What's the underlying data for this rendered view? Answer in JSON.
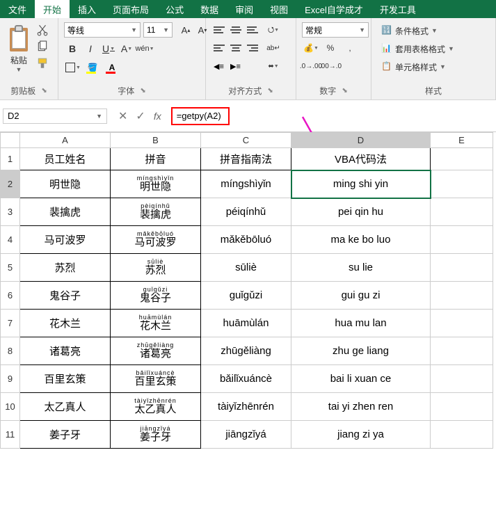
{
  "tabs": [
    "文件",
    "开始",
    "插入",
    "页面布局",
    "公式",
    "数据",
    "审阅",
    "视图",
    "Excel自学成才",
    "开发工具"
  ],
  "active_tab": 1,
  "font": {
    "name": "等线",
    "size": "11"
  },
  "number_format": "常规",
  "groups": {
    "clipboard": "剪贴板",
    "paste": "粘贴",
    "font": "字体",
    "align": "对齐方式",
    "number": "数字",
    "styles": "样式"
  },
  "style_btns": {
    "cond": "条件格式",
    "table": "套用表格格式",
    "cell": "单元格样式"
  },
  "name_box": "D2",
  "formula": "=getpy(A2)",
  "cols": [
    "A",
    "B",
    "C",
    "D",
    "E"
  ],
  "row_nums": [
    "1",
    "2",
    "3",
    "4",
    "5",
    "6",
    "7",
    "8",
    "9",
    "10",
    "11"
  ],
  "header": {
    "A": "员工姓名",
    "B": "拼音",
    "C": "拼音指南法",
    "D": "VBA代码法"
  },
  "rows": [
    {
      "A": "明世隐",
      "B_top": "míngshìyǐn",
      "B": "明世隐",
      "C": "míngshìyǐn",
      "D": "ming shi yin"
    },
    {
      "A": "裴擒虎",
      "B_top": "pèiqínhǔ",
      "B": "裴擒虎",
      "C": "péiqínhǔ",
      "D": "pei qin hu"
    },
    {
      "A": "马可波罗",
      "B_top": "mǎkěbōluó",
      "B": "马可波罗",
      "C": "mǎkěbōluó",
      "D": "ma ke bo luo"
    },
    {
      "A": "苏烈",
      "B_top": "sūliè",
      "B": "苏烈",
      "C": "sūliè",
      "D": "su lie"
    },
    {
      "A": "鬼谷子",
      "B_top": "guǐgǔzi",
      "B": "鬼谷子",
      "C": "guǐgǔzi",
      "D": "gui gu zi"
    },
    {
      "A": "花木兰",
      "B_top": "huāmùlán",
      "B": "花木兰",
      "C": "huāmùlán",
      "D": "hua mu lan"
    },
    {
      "A": "诸葛亮",
      "B_top": "zhūgěliàng",
      "B": "诸葛亮",
      "C": "zhūgěliàng",
      "D": "zhu ge liang"
    },
    {
      "A": "百里玄策",
      "B_top": "bǎilǐxuáncè",
      "B": "百里玄策",
      "C": "bǎilǐxuáncè",
      "D": "bai li xuan ce"
    },
    {
      "A": "太乙真人",
      "B_top": "tàiyǐzhēnrén",
      "B": "太乙真人",
      "C": "tàiyǐzhēnrén",
      "D": "tai yi zhen ren"
    },
    {
      "A": "姜子牙",
      "B_top": "jiāngzǐyá",
      "B": "姜子牙",
      "C": "jiāngzǐyá",
      "D": "jiang zi ya"
    }
  ],
  "selected": {
    "row": 2,
    "col": "D"
  }
}
